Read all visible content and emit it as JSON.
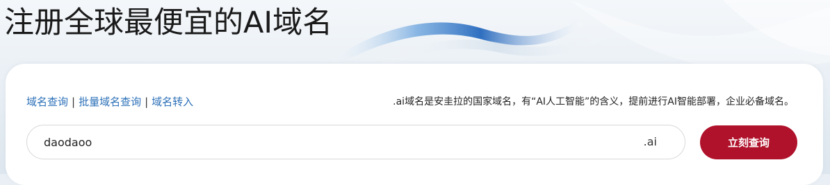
{
  "hero": {
    "title": "注册全球最便宜的AI域名"
  },
  "search_nav": {
    "links": [
      {
        "label": "域名查询"
      },
      {
        "label": "批量域名查询"
      },
      {
        "label": "域名转入"
      }
    ],
    "separator": "|"
  },
  "promo": {
    "text": ".ai域名是安圭拉的国家域名，有“AI人工智能”的含义，提前进行AI智能部署，企业必备域名。"
  },
  "search": {
    "value": "daodaoo",
    "tld": ".ai",
    "button_label": "立刻查询"
  },
  "colors": {
    "link": "#2a6fb8",
    "button": "#b0122b",
    "wave": "#3f7fc9"
  }
}
